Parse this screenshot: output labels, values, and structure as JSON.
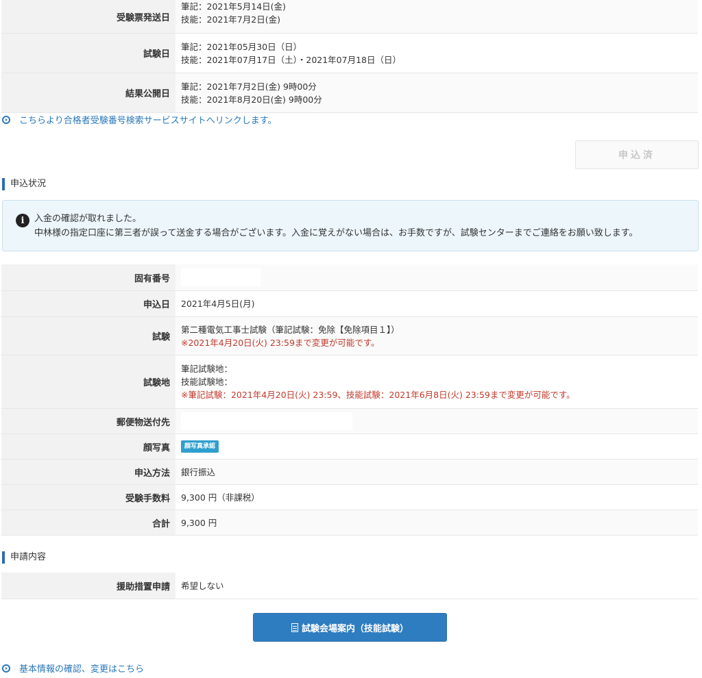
{
  "schedule": {
    "rows": [
      {
        "label": "受験票発送日",
        "line1": "筆記：2021年5月14日(金)",
        "line2": "技能：2021年7月2日(金)"
      },
      {
        "label": "試験日",
        "line1": "筆記：2021年05月30日（日）",
        "line2": "技能：2021年07月17日（土）・2021年07月18日（日）"
      },
      {
        "label": "結果公開日",
        "line1": "筆記：2021年7月2日(金) 9時00分",
        "line2": "技能：2021年8月20日(金) 9時00分"
      }
    ]
  },
  "links": {
    "pass_search": "こちらより合格者受験番号検索サービスサイトへリンクします。",
    "basic_info": "基本情報の確認、変更はこちら"
  },
  "applied_button": "申込済",
  "status_section": {
    "title": "申込状況",
    "info_line1": "入金の確認が取れました。",
    "info_line2": "中林様の指定口座に第三者が誤って送金する場合がございます。入金に覚えがない場合は、お手数ですが、試験センターまでご連絡をお願い致します。"
  },
  "details": {
    "id_label": "固有番号",
    "date_label": "申込日",
    "date_value": "2021年4月5日(月)",
    "exam_label": "試験",
    "exam_value": "第二種電気工事士試験（筆記試験：免除【免除項目１】）",
    "exam_note": "※2021年4月20日(火) 23:59まで変更が可能です。",
    "venue_label": "試験地",
    "venue_written": "筆記試験地：",
    "venue_skill": "技能試験地：",
    "venue_note": "※筆記試験：2021年4月20日(火) 23:59、技能試験：2021年6月8日(火) 23:59まで変更が可能です。",
    "mail_label": "郵便物送付先",
    "photo_label": "顔写真",
    "photo_badge": "顔写真承認",
    "method_label": "申込方法",
    "method_value": "銀行振込",
    "fee_label": "受験手数料",
    "fee_value": "9,300 円（非課税）",
    "total_label": "合計",
    "total_value": "9,300 円"
  },
  "request_section": {
    "title": "申請内容",
    "assist_label": "援助措置申請",
    "assist_value": "希望しない"
  },
  "venue_button": "試験会場案内（技能試験）"
}
